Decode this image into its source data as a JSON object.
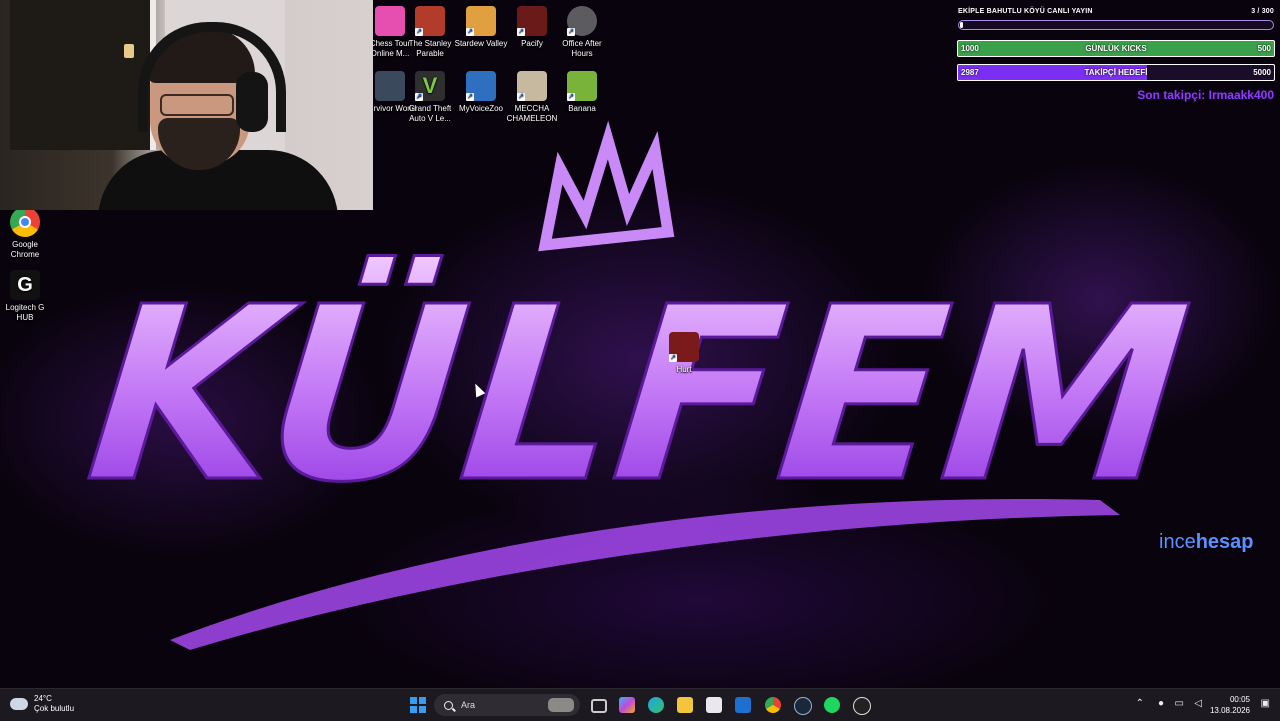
{
  "desktop": {
    "icons": [
      {
        "label": "Chess Tour Online M...",
        "color": "#e64fb0"
      },
      {
        "label": "The Stanley Parable",
        "color": "#b23b2a"
      },
      {
        "label": "Stardew Valley",
        "color": "#e0a040"
      },
      {
        "label": "Pacify",
        "color": "#6b1a1a"
      },
      {
        "label": "Office After Hours",
        "color": "#5c5c60"
      },
      {
        "label": "Survivor World",
        "color": "#3a4a5c"
      },
      {
        "label": "Grand Theft Auto V Le...",
        "color": "#2f2f2f"
      },
      {
        "label": "MyVoiceZoo",
        "color": "#2e6fbf"
      },
      {
        "label": "MECCHA CHAMELEON",
        "color": "#c7b8a0"
      },
      {
        "label": "Banana",
        "color": "#7ab33a"
      },
      {
        "label": "Google Chrome",
        "color": "#4285f4"
      },
      {
        "label": "Logitech G HUB",
        "color": "#111111"
      },
      {
        "label": "Hurt",
        "color": "#7a1a1a"
      }
    ]
  },
  "wallpaper": {
    "logo_text": "KÜLFEM",
    "watermark_thin": "ince",
    "watermark_bold": "hesap"
  },
  "widgets": {
    "top_goal": {
      "label": "EKİPLE BAHUTLU KÖYÜ CANLI YAYIN",
      "count": "3 / 300",
      "progress": 0.01
    },
    "daily_kicks": {
      "current": "1000",
      "label": "GÜNLÜK KICKS",
      "target": "500"
    },
    "follower_goal": {
      "current": "2987",
      "label": "TAKİPÇİ HEDEFİ",
      "target": "5000",
      "progress": 0.597
    },
    "last_follower": "Son takipçi: Irmaakk400"
  },
  "taskbar": {
    "weather_temp": "24°C",
    "weather_desc": "Çok bulutlu",
    "search_placeholder": "Ara",
    "time": "00:05",
    "date": "13.08.2026"
  },
  "colors": {
    "accent_purple": "#8a3ff5",
    "kicks_green": "#3aa14a",
    "watermark_blue": "#5b90ff"
  }
}
